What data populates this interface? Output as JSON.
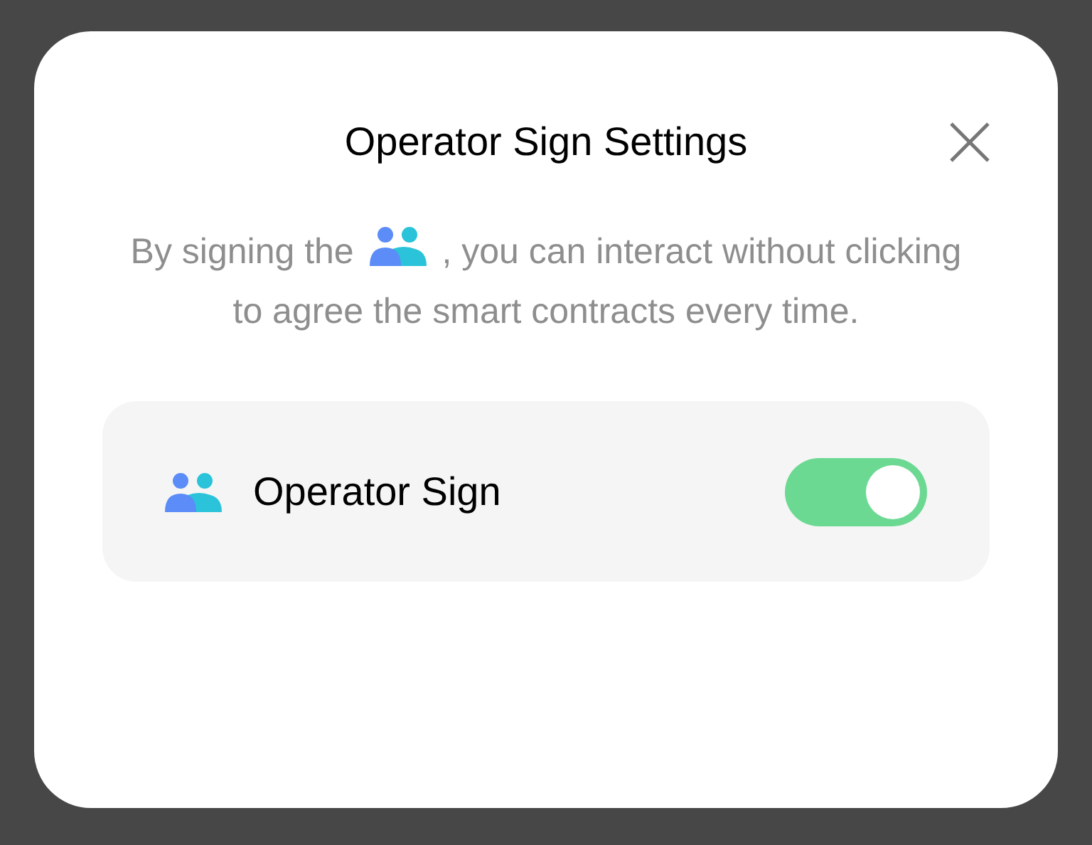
{
  "dialog": {
    "title": "Operator Sign Settings",
    "description_before": "By signing the",
    "description_after": ", you can interact without clicking to agree the smart contracts every time.",
    "setting": {
      "label": "Operator Sign",
      "on": true
    }
  }
}
